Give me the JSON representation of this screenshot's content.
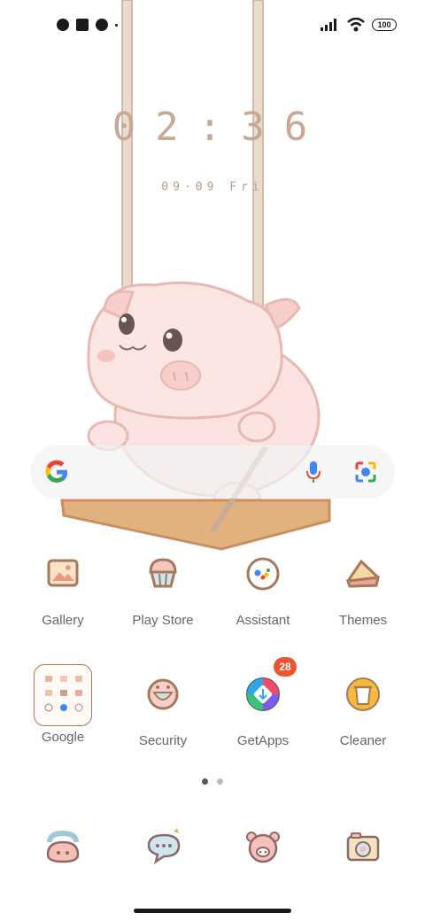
{
  "status": {
    "battery": "100",
    "icons": [
      "notification-icon",
      "square-icon",
      "notification-icon",
      "dot-icon",
      "signal-icon",
      "wifi-icon",
      "battery-icon"
    ]
  },
  "lockscreen": {
    "time": "02:36",
    "date": "09·09 Fri"
  },
  "search": {
    "icons": [
      "google-g-icon",
      "mic-icon",
      "lens-icon"
    ]
  },
  "apps": [
    {
      "label": "Gallery",
      "icon": "gallery-icon"
    },
    {
      "label": "Play Store",
      "icon": "play-store-icon"
    },
    {
      "label": "Assistant",
      "icon": "assistant-icon"
    },
    {
      "label": "Themes",
      "icon": "themes-icon"
    },
    {
      "label": "Google",
      "icon": "google-folder-icon"
    },
    {
      "label": "Security",
      "icon": "security-icon"
    },
    {
      "label": "GetApps",
      "icon": "getapps-icon",
      "badge": "28"
    },
    {
      "label": "Cleaner",
      "icon": "cleaner-icon"
    }
  ],
  "page_indicator": {
    "count": 2,
    "active": 0
  },
  "dock": [
    "phone-icon",
    "messages-icon",
    "browser-icon",
    "camera-icon"
  ],
  "colors": {
    "accent": "#f0542d",
    "pig_pink": "#f8d6d3",
    "rope": "#e0c8b4",
    "clock": "#c9a792"
  }
}
